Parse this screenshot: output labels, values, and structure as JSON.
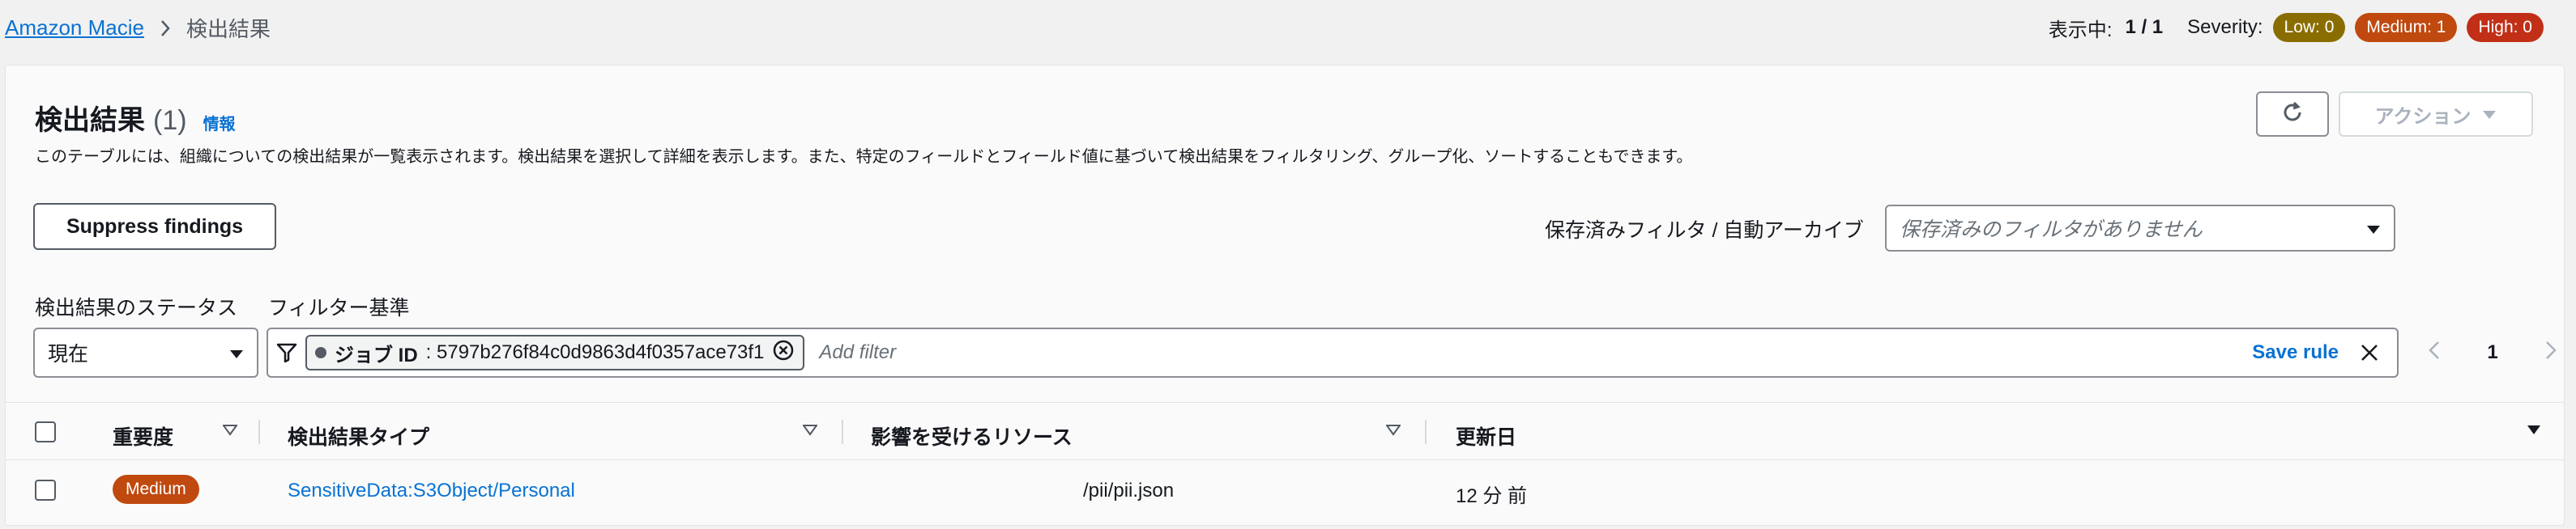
{
  "breadcrumb": {
    "root": "Amazon Macie",
    "current": "検出結果"
  },
  "summary": {
    "showing_label": "表示中:",
    "showing_count": "1 / 1",
    "severity_label": "Severity:",
    "low": "Low: 0",
    "medium": "Medium: 1",
    "high": "High: 0",
    "colors": {
      "low": "#8a6d00",
      "medium": "#c0490f",
      "high": "#c12f17"
    }
  },
  "header": {
    "title": "検出結果",
    "count": "(1)",
    "info": "情報",
    "description": "このテーブルには、組織についての検出結果が一覧表示されます。検出結果を選択して詳細を表示します。また、特定のフィールドとフィールド値に基づいて検出結果をフィルタリング、グループ化、ソートすることもできます。",
    "action_label": "アクション"
  },
  "toolbar": {
    "suppress_label": "Suppress findings",
    "saved_filters_label": "保存済みフィルタ / 自動アーカイブ",
    "saved_filters_placeholder": "保存済みのフィルタがありません"
  },
  "filters": {
    "status_label": "検出結果のステータス",
    "status_value": "現在",
    "criteria_label": "フィルター基準",
    "token_key": "ジョブ ID",
    "token_value": ": 5797b276f84c0d9863d4f0357ace73f1",
    "add_filter_placeholder": "Add filter",
    "save_rule": "Save rule"
  },
  "pagination": {
    "page": "1"
  },
  "table": {
    "columns": [
      "重要度",
      "検出結果タイプ",
      "影響を受けるリソース",
      "更新日"
    ],
    "rows": [
      {
        "severity": "Medium",
        "type": "SensitiveData:S3Object/Personal",
        "resource": "/pii/pii.json",
        "updated": "12 分 前"
      }
    ]
  },
  "icons": [
    "chevron-right-icon",
    "refresh-icon",
    "caret-down-icon",
    "filter-icon",
    "remove-token-icon",
    "close-icon",
    "chevron-left-icon",
    "sort-icon"
  ]
}
